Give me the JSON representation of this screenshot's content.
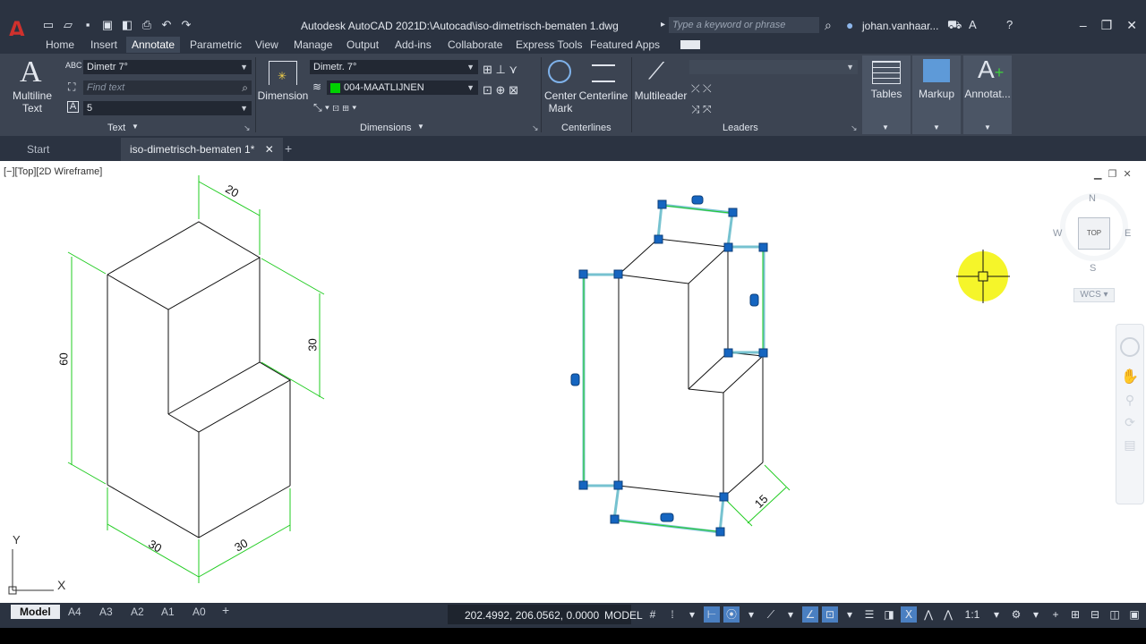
{
  "app": {
    "logo": "A",
    "title": "Autodesk AutoCAD 2021",
    "file_path": "D:\\Autocad\\iso-dimetrisch-bematen 1.dwg",
    "search_placeholder": "Type a keyword or phrase",
    "user": "johan.vanhaar..."
  },
  "ribbon_tabs": [
    {
      "label": "Home"
    },
    {
      "label": "Insert"
    },
    {
      "label": "Annotate"
    },
    {
      "label": "Parametric"
    },
    {
      "label": "View"
    },
    {
      "label": "Manage"
    },
    {
      "label": "Output"
    },
    {
      "label": "Add-ins"
    },
    {
      "label": "Collaborate"
    },
    {
      "label": "Express Tools"
    },
    {
      "label": "Featured Apps"
    }
  ],
  "ribbon": {
    "multiline_text": "Multiline Text",
    "multiline_text_l1": "Multiline",
    "multiline_text_l2": "Text",
    "text_style": "Dimetr 7°",
    "find_text_placeholder": "Find text",
    "text_height": "5",
    "text_panel": "Text",
    "dimension": "Dimension",
    "dim_style": "Dimetr. 7°",
    "dim_layer": "004-MAATLIJNEN",
    "dimensions_panel": "Dimensions",
    "center_mark_l1": "Center",
    "center_mark_l2": "Mark",
    "centerline": "Centerline",
    "centerlines_panel": "Centerlines",
    "multileader": "Multileader",
    "leaders_panel": "Leaders",
    "tables": "Tables",
    "markup": "Markup",
    "annotate_more": "Annotat..."
  },
  "doc_tabs": [
    {
      "label": "Start"
    },
    {
      "label": "iso-dimetrisch-bematen 1*"
    }
  ],
  "viewport": {
    "label": "[−][Top][2D Wireframe]"
  },
  "drawing": {
    "left_dims": [
      "20",
      "30",
      "60",
      "30",
      "30"
    ],
    "right_dims": [
      "15"
    ],
    "ucs_x": "X",
    "ucs_y": "Y"
  },
  "viewcube": {
    "n": "N",
    "s": "S",
    "e": "E",
    "w": "W",
    "face": "TOP",
    "wcs": "WCS"
  },
  "layout_tabs": [
    {
      "label": "Model"
    },
    {
      "label": "A4"
    },
    {
      "label": "A3"
    },
    {
      "label": "A2"
    },
    {
      "label": "A1"
    },
    {
      "label": "A0"
    }
  ],
  "status": {
    "coordinates": "202.4992, 206.0562, 0.0000",
    "space": "MODEL",
    "scale": "1:1"
  },
  "colors": {
    "dim_green": "#22cc22",
    "grip_blue": "#1565c0",
    "cursor_yellow": "#f5f52a",
    "layer_swatch": "#00d200"
  }
}
